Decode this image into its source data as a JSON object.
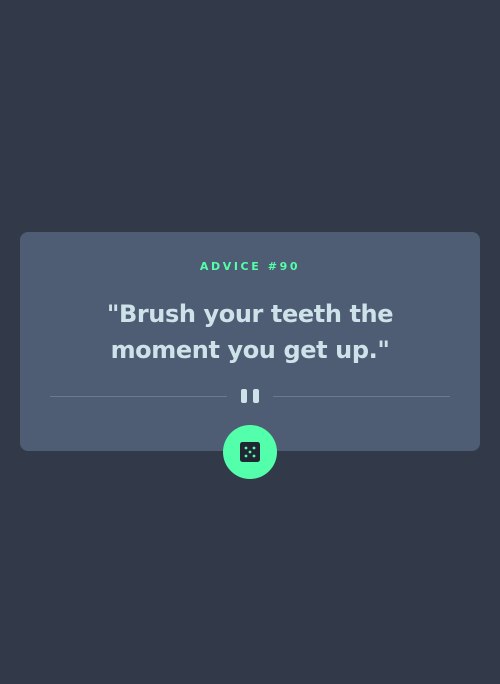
{
  "advice": {
    "label": "ADVICE #90",
    "quote": "\"Brush your teeth the moment you get up.\""
  },
  "controls": {
    "divider_icon": "pause-icon",
    "dice_icon": "dice-icon"
  },
  "colors": {
    "background": "#323a49",
    "card": "#4e5d73",
    "accent": "#53ffaa",
    "quote_text": "#cee3e9",
    "divider": "#6a7a91"
  }
}
